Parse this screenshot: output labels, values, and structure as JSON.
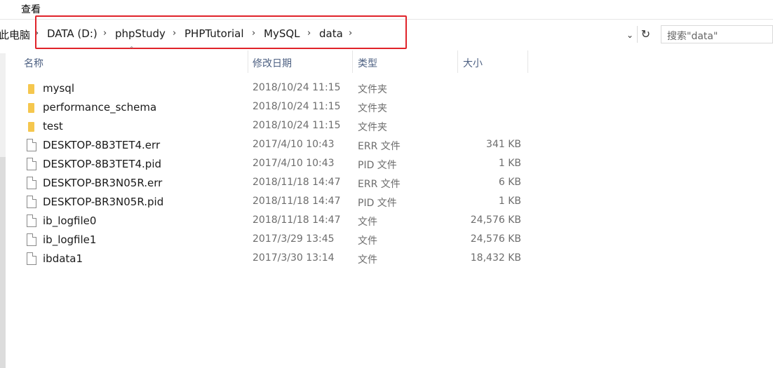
{
  "menu": {
    "view_label": "查看"
  },
  "address": {
    "crumbs": [
      "此电脑",
      "DATA (D:)",
      "phpStudy",
      "PHPTutorial",
      "MySQL",
      "data"
    ],
    "separator": "›"
  },
  "search": {
    "placeholder": "搜索\"data\""
  },
  "columns": {
    "name": "名称",
    "date": "修改日期",
    "type": "类型",
    "size": "大小"
  },
  "icons": {
    "folder": "folder-icon",
    "file": "file-icon",
    "refresh": "refresh-icon",
    "dropdown": "chevron-down-icon",
    "sort": "sort-up-icon"
  },
  "colors": {
    "highlight": "#e0232a",
    "folder": "#f5c74e",
    "header_text": "#4d6082"
  },
  "files": [
    {
      "name": "mysql",
      "date": "2018/10/24 11:15",
      "type": "文件夹",
      "size": "",
      "kind": "folder"
    },
    {
      "name": "performance_schema",
      "date": "2018/10/24 11:15",
      "type": "文件夹",
      "size": "",
      "kind": "folder"
    },
    {
      "name": "test",
      "date": "2018/10/24 11:15",
      "type": "文件夹",
      "size": "",
      "kind": "folder"
    },
    {
      "name": "DESKTOP-8B3TET4.err",
      "date": "2017/4/10 10:43",
      "type": "ERR 文件",
      "size": "341 KB",
      "kind": "file"
    },
    {
      "name": "DESKTOP-8B3TET4.pid",
      "date": "2017/4/10 10:43",
      "type": "PID 文件",
      "size": "1 KB",
      "kind": "file"
    },
    {
      "name": "DESKTOP-BR3N05R.err",
      "date": "2018/11/18 14:47",
      "type": "ERR 文件",
      "size": "6 KB",
      "kind": "file"
    },
    {
      "name": "DESKTOP-BR3N05R.pid",
      "date": "2018/11/18 14:47",
      "type": "PID 文件",
      "size": "1 KB",
      "kind": "file"
    },
    {
      "name": "ib_logfile0",
      "date": "2018/11/18 14:47",
      "type": "文件",
      "size": "24,576 KB",
      "kind": "file"
    },
    {
      "name": "ib_logfile1",
      "date": "2017/3/29 13:45",
      "type": "文件",
      "size": "24,576 KB",
      "kind": "file"
    },
    {
      "name": "ibdata1",
      "date": "2017/3/30 13:14",
      "type": "文件",
      "size": "18,432 KB",
      "kind": "file"
    }
  ]
}
